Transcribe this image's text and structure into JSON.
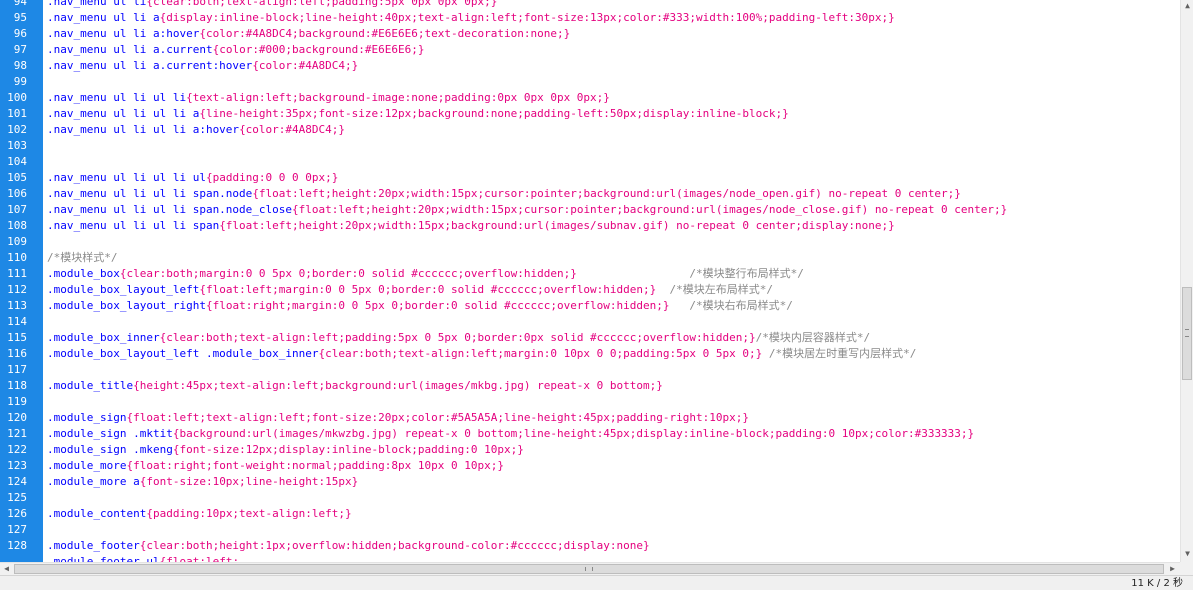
{
  "editor": {
    "lines": [
      {
        "n": "94",
        "sel": ".nav_menu ul li",
        "dec": "{clear:both;text-align:left;padding:5px 0px 0px 0px;}",
        "cmt": ""
      },
      {
        "n": "95",
        "sel": ".nav_menu ul li a",
        "dec": "{display:inline-block;line-height:40px;text-align:left;font-size:13px;color:#333;width:100%;padding-left:30px;}",
        "cmt": ""
      },
      {
        "n": "96",
        "sel": ".nav_menu ul li a:hover",
        "dec": "{color:#4A8DC4;background:#E6E6E6;text-decoration:none;}",
        "cmt": ""
      },
      {
        "n": "97",
        "sel": ".nav_menu ul li a.current",
        "dec": "{color:#000;background:#E6E6E6;}",
        "cmt": ""
      },
      {
        "n": "98",
        "sel": ".nav_menu ul li a.current:hover",
        "dec": "{color:#4A8DC4;}",
        "cmt": ""
      },
      {
        "n": "99",
        "sel": "",
        "dec": "",
        "cmt": ""
      },
      {
        "n": "100",
        "sel": ".nav_menu ul li ul li",
        "dec": "{text-align:left;background-image:none;padding:0px 0px 0px 0px;}",
        "cmt": ""
      },
      {
        "n": "101",
        "sel": ".nav_menu ul li ul li a",
        "dec": "{line-height:35px;font-size:12px;background:none;padding-left:50px;display:inline-block;}",
        "cmt": ""
      },
      {
        "n": "102",
        "sel": ".nav_menu ul li ul li a:hover",
        "dec": "{color:#4A8DC4;}",
        "cmt": ""
      },
      {
        "n": "103",
        "sel": "",
        "dec": "",
        "cmt": ""
      },
      {
        "n": "104",
        "sel": "",
        "dec": "",
        "cmt": ""
      },
      {
        "n": "105",
        "sel": ".nav_menu ul li ul li ul",
        "dec": "{padding:0 0 0 0px;}",
        "cmt": ""
      },
      {
        "n": "106",
        "sel": ".nav_menu ul li ul li span.node",
        "dec": "{float:left;height:20px;width:15px;cursor:pointer;background:url(images/node_open.gif) no-repeat 0 center;}",
        "cmt": ""
      },
      {
        "n": "107",
        "sel": ".nav_menu ul li ul li span.node_close",
        "dec": "{float:left;height:20px;width:15px;cursor:pointer;background:url(images/node_close.gif) no-repeat 0 center;}",
        "cmt": ""
      },
      {
        "n": "108",
        "sel": ".nav_menu ul li ul li span",
        "dec": "{float:left;height:20px;width:15px;background:url(images/subnav.gif) no-repeat 0 center;display:none;}",
        "cmt": ""
      },
      {
        "n": "109",
        "sel": "",
        "dec": "",
        "cmt": ""
      },
      {
        "n": "110",
        "sel": "",
        "dec": "",
        "cmt": "/*模块样式*/"
      },
      {
        "n": "111",
        "sel": ".module_box",
        "dec": "{clear:both;margin:0 0 5px 0;border:0 solid #cccccc;overflow:hidden;}",
        "cmt": "                 /*模块整行布局样式*/"
      },
      {
        "n": "112",
        "sel": ".module_box_layout_left",
        "dec": "{float:left;margin:0 0 5px 0;border:0 solid #cccccc;overflow:hidden;}",
        "cmt": "  /*模块左布局样式*/"
      },
      {
        "n": "113",
        "sel": ".module_box_layout_right",
        "dec": "{float:right;margin:0 0 5px 0;border:0 solid #cccccc;overflow:hidden;}",
        "cmt": "   /*模块右布局样式*/"
      },
      {
        "n": "114",
        "sel": "",
        "dec": "",
        "cmt": ""
      },
      {
        "n": "115",
        "sel": ".module_box_inner",
        "dec": "{clear:both;text-align:left;padding:5px 0 5px 0;border:0px solid #cccccc;overflow:hidden;}",
        "cmt": "/*模块内层容器样式*/"
      },
      {
        "n": "116",
        "sel": ".module_box_layout_left .module_box_inner",
        "dec": "{clear:both;text-align:left;margin:0 10px 0 0;padding:5px 0 5px 0;}",
        "cmt": " /*模块居左时重写内层样式*/"
      },
      {
        "n": "117",
        "sel": "",
        "dec": "",
        "cmt": ""
      },
      {
        "n": "118",
        "sel": ".module_title",
        "dec": "{height:45px;text-align:left;background:url(images/mkbg.jpg) repeat-x 0 bottom;}",
        "cmt": ""
      },
      {
        "n": "119",
        "sel": "",
        "dec": "",
        "cmt": ""
      },
      {
        "n": "120",
        "sel": ".module_sign",
        "dec": "{float:left;text-align:left;font-size:20px;color:#5A5A5A;line-height:45px;padding-right:10px;}",
        "cmt": ""
      },
      {
        "n": "121",
        "sel": ".module_sign .mktit",
        "dec": "{background:url(images/mkwzbg.jpg) repeat-x 0 bottom;line-height:45px;display:inline-block;padding:0 10px;color:#333333;}",
        "cmt": ""
      },
      {
        "n": "122",
        "sel": ".module_sign .mkeng",
        "dec": "{font-size:12px;display:inline-block;padding:0 10px;}",
        "cmt": ""
      },
      {
        "n": "123",
        "sel": ".module_more",
        "dec": "{float:right;font-weight:normal;padding:8px 10px 0 10px;}",
        "cmt": ""
      },
      {
        "n": "124",
        "sel": ".module_more a",
        "dec": "{font-size:10px;line-height:15px}",
        "cmt": ""
      },
      {
        "n": "125",
        "sel": "",
        "dec": "",
        "cmt": ""
      },
      {
        "n": "126",
        "sel": ".module_content",
        "dec": "{padding:10px;text-align:left;}",
        "cmt": ""
      },
      {
        "n": "127",
        "sel": "",
        "dec": "",
        "cmt": ""
      },
      {
        "n": "128",
        "sel": ".module_footer",
        "dec": "{clear:both;height:1px;overflow:hidden;background-color:#cccccc;display:none}",
        "cmt": ""
      },
      {
        "n": "",
        "sel": ".module_footer ul",
        "dec": "{float:left;",
        "cmt": ""
      }
    ]
  },
  "statusbar": {
    "text": "11 K / 2 秒"
  },
  "colors": {
    "gutter": "#1e88e5",
    "selector": "#0000ff",
    "declaration": "#e4007f",
    "comment": "#8a8a8a"
  },
  "icons": [
    "scroll-up-arrow-icon",
    "scroll-down-arrow-icon",
    "scroll-left-arrow-icon",
    "scroll-right-arrow-icon"
  ]
}
